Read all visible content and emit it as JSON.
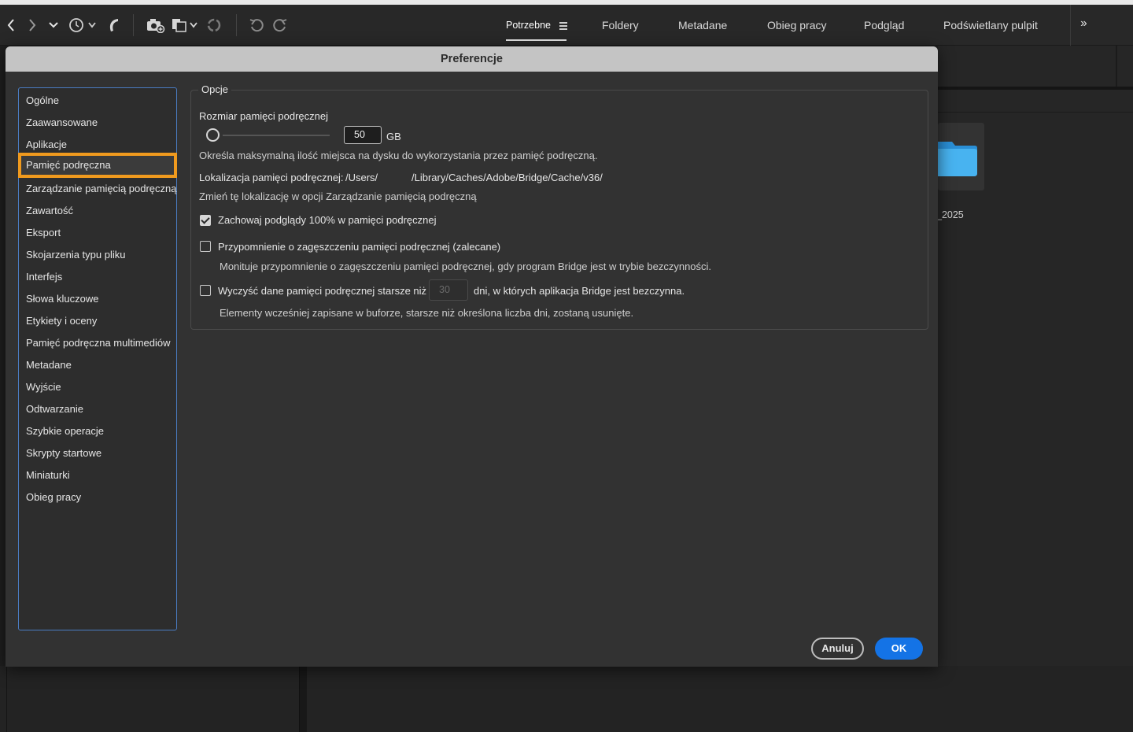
{
  "workspace_tabs": [
    {
      "label": "Potrzebne",
      "active": true
    },
    {
      "label": "Foldery"
    },
    {
      "label": "Metadane"
    },
    {
      "label": "Obieg pracy"
    },
    {
      "label": "Podgląd"
    },
    {
      "label": "Podświetlany pulpit"
    }
  ],
  "toolbar_icons": [
    "back-icon",
    "forward-icon",
    "chevron-down-icon",
    "history-icon",
    "boomerang-icon",
    "camera-import-icon",
    "copy-icon",
    "refresh-icon",
    "undo-icon",
    "redo-icon",
    "more-workspaces-icon"
  ],
  "background": {
    "folder_label": "_2025"
  },
  "dialog": {
    "title": "Preferencje",
    "categories": [
      "Ogólne",
      "Zaawansowane",
      "Aplikacje",
      "Pamięć podręczna",
      "Zarządzanie pamięcią podręczną",
      "Zawartość",
      "Eksport",
      "Skojarzenia typu pliku",
      "Interfejs",
      "Słowa kluczowe",
      "Etykiety i oceny",
      "Pamięć podręczna multimediów",
      "Metadane",
      "Wyjście",
      "Odtwarzanie",
      "Szybkie operacje",
      "Skrypty startowe",
      "Miniaturki",
      "Obieg pracy"
    ],
    "selected_category": "Pamięć podręczna",
    "options": {
      "legend": "Opcje",
      "cache_size_label": "Rozmiar pamięci podręcznej",
      "cache_size_value": "50",
      "cache_size_unit": "GB",
      "cache_size_desc": "Określa maksymalną ilość miejsca na dysku do wykorzystania przez pamięć podręczną.",
      "location_label": "Lokalizacja pamięci podręcznej:",
      "location_value_a": "/Users/",
      "location_value_b": "/Library/Caches/Adobe/Bridge/Cache/v36/",
      "location_hint": "Zmień tę lokalizację w opcji Zarządzanie pamięcią podręczną",
      "keep_previews_label": "Zachowaj podglądy 100% w pamięci podręcznej",
      "keep_previews_checked": true,
      "compact_reminder_label": "Przypomnienie o zagęszczeniu pamięci podręcznej (zalecane)",
      "compact_reminder_checked": false,
      "compact_reminder_desc": "Monituje przypomnienie o zagęszczeniu pamięci podręcznej, gdy program Bridge jest w trybie bezczynności.",
      "purge_label": "Wyczyść dane pamięci podręcznej starsze niż",
      "purge_checked": false,
      "purge_days_value": "30",
      "purge_suffix": "dni, w których aplikacja Bridge jest bezczynna.",
      "purge_desc": "Elementy wcześniej zapisane w buforze, starsze niż określona liczba dni, zostaną usunięte."
    },
    "cancel_label": "Anuluj",
    "ok_label": "OK"
  },
  "colors": {
    "accent_blue": "#1473e6",
    "selection_orange": "#f09a1e",
    "list_border": "#4a7cc2"
  }
}
